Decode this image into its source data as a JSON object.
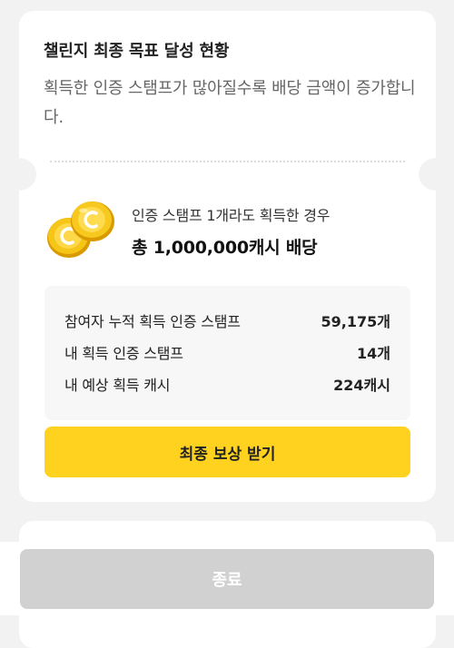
{
  "challenge": {
    "title": "챌린지 최종 목표 달성 현황",
    "description": "획득한 인증 스탬프가 많아질수록 배당 금액이 증가합니다."
  },
  "reward": {
    "caption": "인증 스탬프 1개라도 획득한 경우",
    "amount": "총 1,000,000캐시 배당",
    "icon": "coin-icon"
  },
  "stats": [
    {
      "label": "참여자 누적 획득 인증 스탬프",
      "value": "59,175개"
    },
    {
      "label": "내 획득 인증 스탬프",
      "value": "14개"
    },
    {
      "label": "내 예상 획득 캐시",
      "value": "224캐시"
    }
  ],
  "claim_button": {
    "label": "최종 보상 받기"
  },
  "close_button": {
    "label": "종료"
  },
  "colors": {
    "accent": "#ffd21f",
    "coin": "#f5c518",
    "disabled": "#d1d1d1",
    "background": "#f2f2f2"
  }
}
